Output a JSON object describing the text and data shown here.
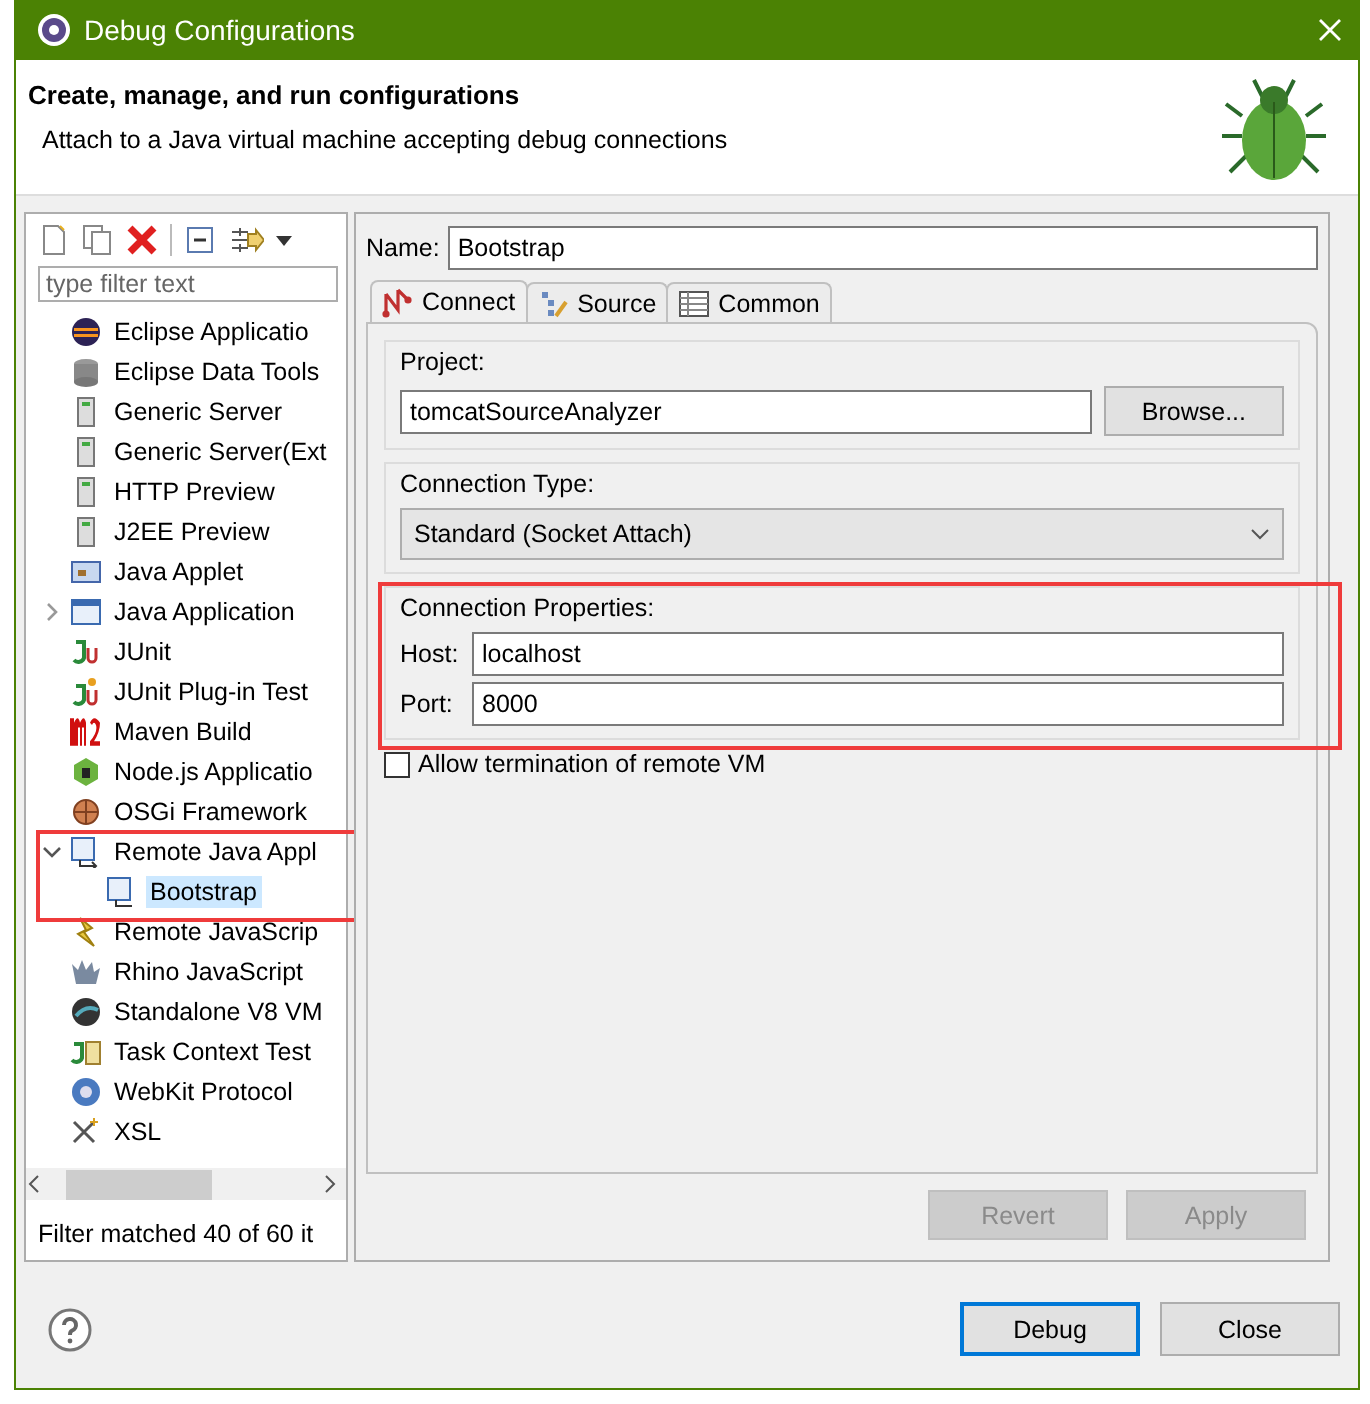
{
  "window": {
    "title": "Debug Configurations"
  },
  "header": {
    "title": "Create, manage, and run configurations",
    "message": "Attach to a Java virtual machine accepting debug connections"
  },
  "sidebar": {
    "filter": {
      "placeholder": "type filter text"
    },
    "items": [
      {
        "label": "Eclipse Applicatio",
        "selected": false
      },
      {
        "label": "Eclipse Data Tools",
        "selected": false
      },
      {
        "label": "Generic Server",
        "selected": false
      },
      {
        "label": "Generic Server(Ext",
        "selected": false
      },
      {
        "label": "HTTP Preview",
        "selected": false
      },
      {
        "label": "J2EE Preview",
        "selected": false
      },
      {
        "label": "Java Applet",
        "selected": false
      },
      {
        "label": "Java Application",
        "selected": false,
        "expanded": false
      },
      {
        "label": "JUnit",
        "selected": false
      },
      {
        "label": "JUnit Plug-in Test",
        "selected": false
      },
      {
        "label": "Maven Build",
        "selected": false
      },
      {
        "label": "Node.js Applicatio",
        "selected": false
      },
      {
        "label": "OSGi Framework",
        "selected": false
      },
      {
        "label": "Remote Java Appl",
        "selected": false,
        "expanded": true,
        "outlined": true,
        "children": [
          {
            "label": "Bootstrap",
            "selected": true
          }
        ]
      },
      {
        "label": "Remote JavaScrip",
        "selected": false
      },
      {
        "label": "Rhino JavaScript",
        "selected": false
      },
      {
        "label": "Standalone V8 VM",
        "selected": false
      },
      {
        "label": "Task Context Test",
        "selected": false
      },
      {
        "label": "WebKit Protocol",
        "selected": false
      },
      {
        "label": "XSL",
        "selected": false
      }
    ],
    "status": "Filter matched 40 of 60 it"
  },
  "config": {
    "name_label": "Name:",
    "name": "Bootstrap",
    "tabs": [
      {
        "label": "Connect",
        "selected": true
      },
      {
        "label": "Source",
        "selected": false
      },
      {
        "label": "Common",
        "selected": false
      }
    ],
    "project": {
      "label": "Project:",
      "value": "tomcatSourceAnalyzer",
      "button": "Browse..."
    },
    "connection_type": {
      "label": "Connection Type:",
      "value": "Standard (Socket Attach)"
    },
    "connection_properties": {
      "label": "Connection Properties:",
      "outlined": true,
      "fields": [
        {
          "label": "Host:",
          "value": "localhost"
        },
        {
          "label": "Port:",
          "value": "8000"
        }
      ]
    },
    "allow_termination": {
      "label": "Allow termination of remote VM",
      "checked": false
    },
    "buttons": [
      {
        "label": "Revert",
        "disabled": true
      },
      {
        "label": "Apply",
        "disabled": true
      }
    ]
  },
  "buttons": [
    {
      "label": "Debug",
      "focused": true
    },
    {
      "label": "Close",
      "focused": false
    }
  ]
}
